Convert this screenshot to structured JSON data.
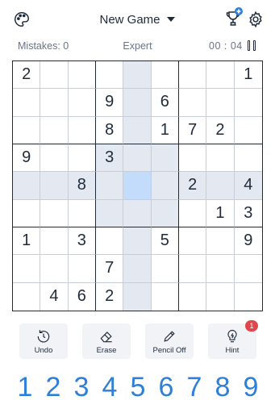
{
  "header": {
    "title": "New Game"
  },
  "status": {
    "mistakes": "Mistakes: 0",
    "difficulty": "Expert",
    "timer": "00 : 04"
  },
  "board": {
    "grid": [
      [
        "2",
        "",
        "",
        "",
        "",
        "",
        "",
        "",
        "1"
      ],
      [
        "",
        "",
        "",
        "9",
        "",
        "6",
        "",
        "",
        ""
      ],
      [
        "",
        "",
        "",
        "8",
        "",
        "1",
        "7",
        "2",
        ""
      ],
      [
        "9",
        "",
        "",
        "3",
        "",
        "",
        "",
        "",
        ""
      ],
      [
        "",
        "",
        "8",
        "",
        "",
        "",
        "2",
        "",
        "4"
      ],
      [
        "",
        "",
        "",
        "",
        "",
        "",
        "",
        "1",
        "3"
      ],
      [
        "1",
        "",
        "3",
        "",
        "",
        "5",
        "",
        "",
        "9"
      ],
      [
        "",
        "",
        "",
        "7",
        "",
        "",
        "",
        "",
        ""
      ],
      [
        "",
        "4",
        "6",
        "2",
        "",
        "",
        "",
        "",
        ""
      ]
    ],
    "selected": [
      4,
      4
    ]
  },
  "tools": [
    {
      "label": "Undo",
      "icon": "undo-icon"
    },
    {
      "label": "Erase",
      "icon": "eraser-icon"
    },
    {
      "label": "Pencil Off",
      "icon": "pencil-icon"
    },
    {
      "label": "Hint",
      "icon": "lightbulb-icon",
      "badge": "1"
    }
  ],
  "numpad": [
    "1",
    "2",
    "3",
    "4",
    "5",
    "6",
    "7",
    "8",
    "9"
  ],
  "colors": {
    "accent": "#2f7fd6",
    "highlight": "#e3e8f1",
    "selected": "#c4dcfb",
    "badge": "#e0474c"
  }
}
